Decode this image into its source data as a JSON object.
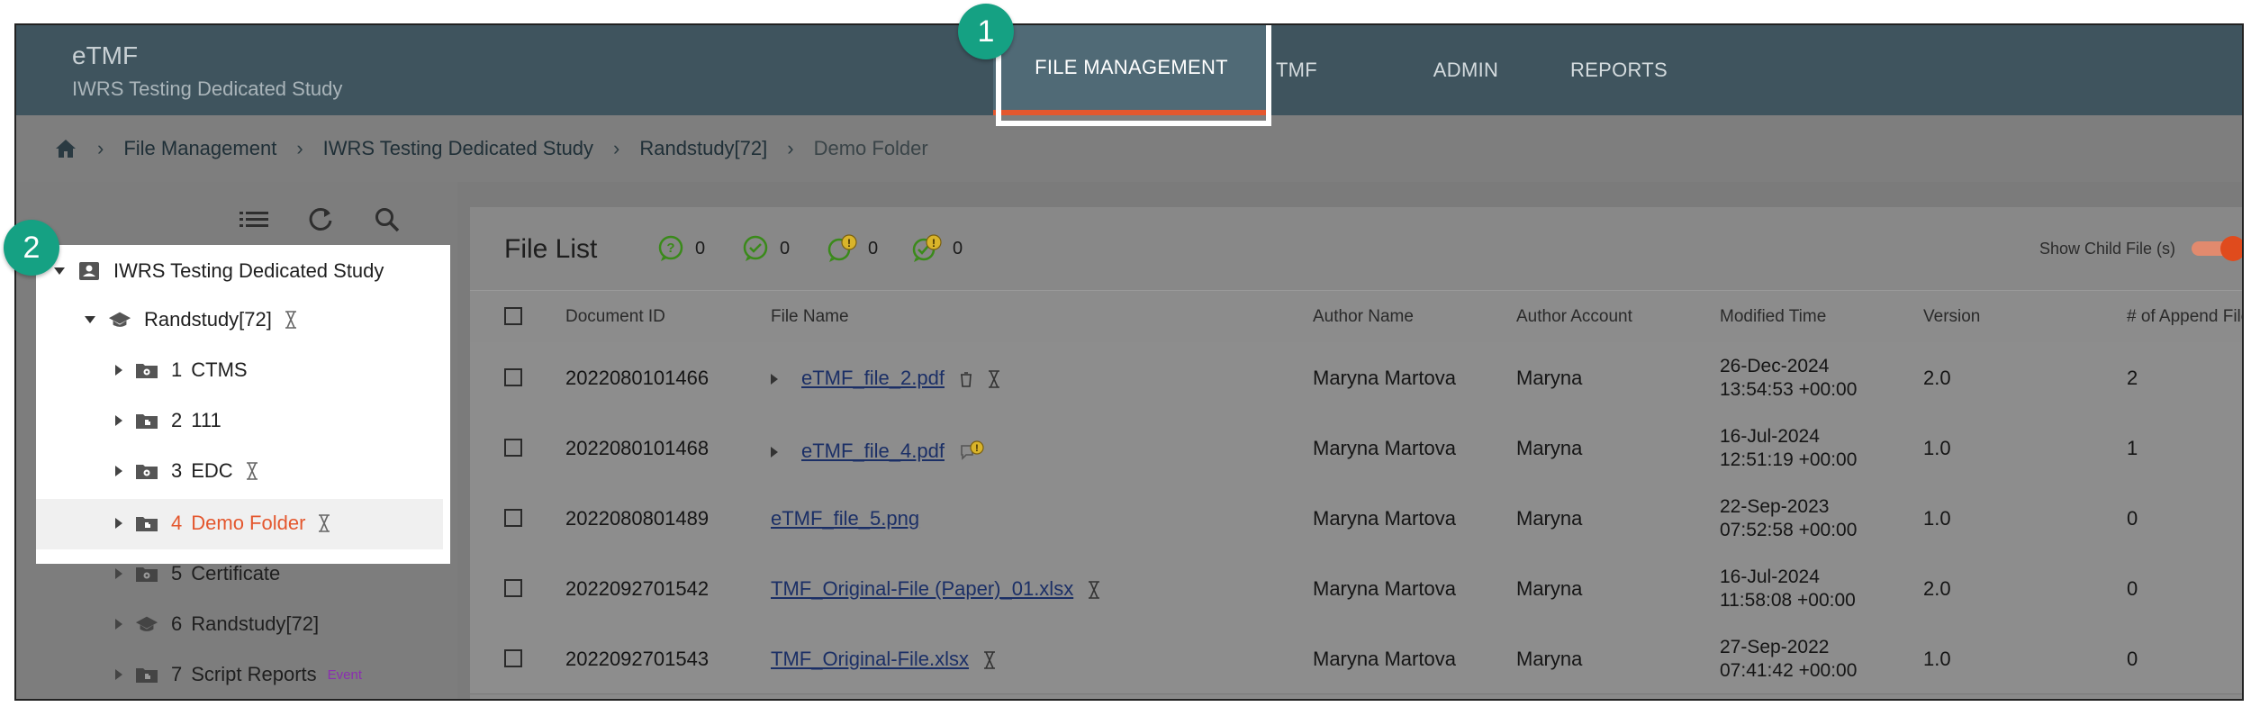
{
  "header": {
    "app_title": "eTMF",
    "study_name": "IWRS Testing Dedicated Study",
    "tabs": [
      {
        "label": "FILE MANAGEMENT",
        "active": true
      },
      {
        "label": "TMF"
      },
      {
        "label": "ADMIN"
      },
      {
        "label": "REPORTS"
      }
    ]
  },
  "breadcrumb": [
    "File Management",
    "IWRS Testing Dedicated Study",
    "Randstudy[72]",
    "Demo Folder"
  ],
  "callouts": [
    "1",
    "2"
  ],
  "tree": {
    "root": "IWRS Testing Dedicated Study",
    "study": "Randstudy[72]",
    "folders": [
      {
        "num": "1",
        "name": "CTMS"
      },
      {
        "num": "2",
        "name": "111"
      },
      {
        "num": "3",
        "name": "EDC"
      },
      {
        "num": "4",
        "name": "Demo Folder",
        "selected": true
      },
      {
        "num": "5",
        "name": "Certificate"
      },
      {
        "num": "6",
        "name": "Randstudy[72]"
      },
      {
        "num": "7",
        "name": "Script Reports",
        "tag": "Event"
      }
    ]
  },
  "file_list": {
    "title": "File List",
    "stats": [
      "0",
      "0",
      "0",
      "0"
    ],
    "show_child_label": "Show Child File (s)",
    "columns": [
      "Document ID",
      "File Name",
      "Author Name",
      "Author Account",
      "Modified Time",
      "Version",
      "# of Append Files"
    ],
    "rows": [
      {
        "doc_id": "2022080101466",
        "file_name": "eTMF_file_2.pdf",
        "author": "Maryna Martova",
        "account": "Maryna",
        "time_date": "26-Dec-2024",
        "time_clock": "13:54:53 +00:00",
        "version": "2.0",
        "append": "2"
      },
      {
        "doc_id": "2022080101468",
        "file_name": "eTMF_file_4.pdf",
        "author": "Maryna Martova",
        "account": "Maryna",
        "time_date": "16-Jul-2024",
        "time_clock": "12:51:19 +00:00",
        "version": "1.0",
        "append": "1"
      },
      {
        "doc_id": "2022080801489",
        "file_name": "eTMF_file_5.png",
        "author": "Maryna Martova",
        "account": "Maryna",
        "time_date": "22-Sep-2023",
        "time_clock": "07:52:58 +00:00",
        "version": "1.0",
        "append": "0"
      },
      {
        "doc_id": "2022092701542",
        "file_name": "TMF_Original-File (Paper)_01.xlsx",
        "author": "Maryna Martova",
        "account": "Maryna",
        "time_date": "16-Jul-2024",
        "time_clock": "11:58:08 +00:00",
        "version": "2.0",
        "append": "0"
      },
      {
        "doc_id": "2022092701543",
        "file_name": "TMF_Original-File.xlsx",
        "author": "Maryna Martova",
        "account": "Maryna",
        "time_date": "27-Sep-2022",
        "time_clock": "07:41:42 +00:00",
        "version": "1.0",
        "append": "0"
      }
    ]
  },
  "colors": {
    "header_bg": "#3f545e",
    "active_tab_underline": "#e4572e",
    "selected_folder": "#e4572e",
    "callout": "#15a183",
    "event_tag": "#8b2fb0"
  }
}
